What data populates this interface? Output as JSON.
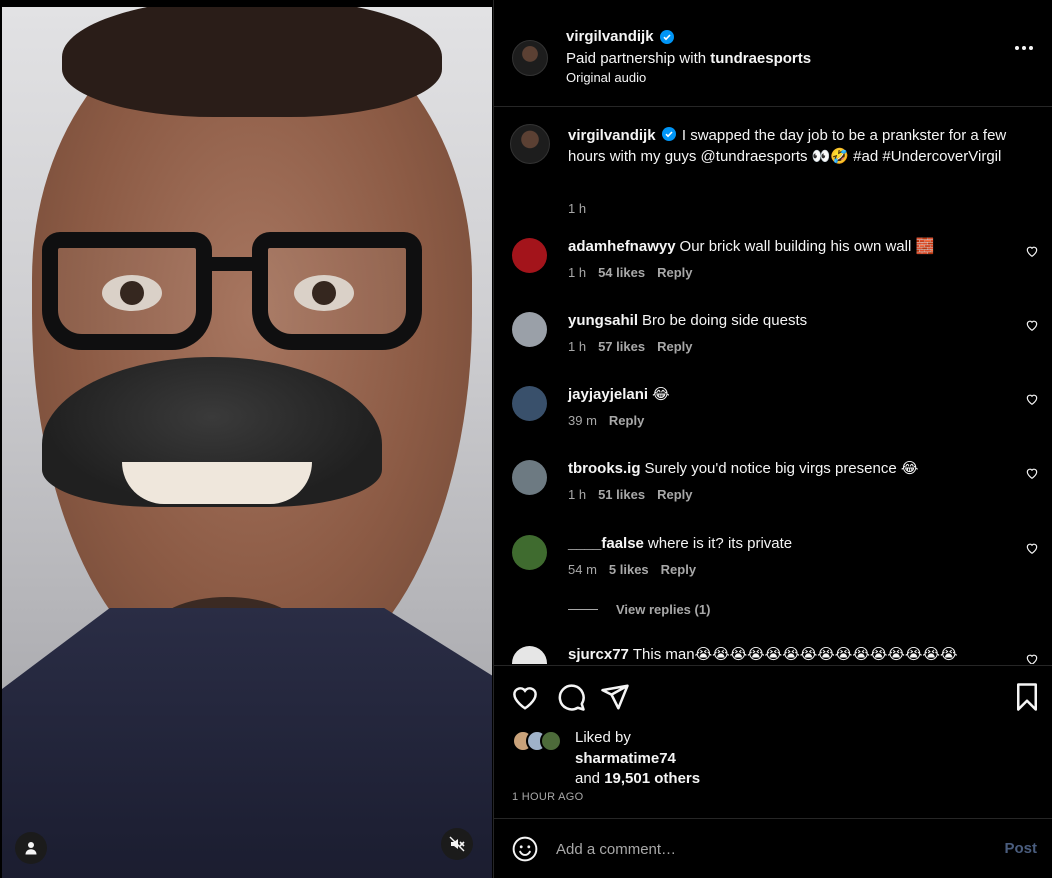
{
  "media": {
    "tag_icon": "person-icon",
    "mute_icon": "speaker-muted-icon"
  },
  "header": {
    "username": "virgilvandijk",
    "partnership_prefix": "Paid partnership with",
    "partner": "tundraesports",
    "audio": "Original audio",
    "more_icon": "more-horizontal-icon"
  },
  "caption": {
    "username": "virgilvandijk",
    "text": "I swapped the day job to be a prankster for a few hours with my guys @tundraesports 👀🤣 #ad #UndercoverVirgil",
    "time": "1 h"
  },
  "comments": [
    {
      "username": "adamhefnawyy",
      "text": "Our brick wall building his own wall 🧱",
      "time": "1 h",
      "likes": "54 likes",
      "reply": "Reply",
      "avatar_color": "#a3141b"
    },
    {
      "username": "yungsahil",
      "text": "Bro be doing side quests",
      "time": "1 h",
      "likes": "57 likes",
      "reply": "Reply",
      "avatar_color": "#9aa0a8"
    },
    {
      "username": "jayjayjelani",
      "text": "😂",
      "time": "39 m",
      "likes": "",
      "reply": "Reply",
      "avatar_color": "#39506b"
    },
    {
      "username": "tbrooks.ig",
      "text": "Surely you'd notice big virgs presence 😂",
      "time": "1 h",
      "likes": "51 likes",
      "reply": "Reply",
      "avatar_color": "#6d7a82"
    },
    {
      "username": "____faalse",
      "text": "where is it? its private",
      "time": "54 m",
      "likes": "5 likes",
      "reply": "Reply",
      "avatar_color": "#3f6b2f"
    },
    {
      "username": "sjurcx77",
      "text": "This man😭😭😭😭😭😭😭😭😭😭😭😭😭😭😭",
      "time": "",
      "likes": "",
      "reply": "",
      "avatar_color": "#e6e6e6"
    }
  ],
  "view_replies": "View replies (1)",
  "actions": {
    "like_icon": "heart-icon",
    "comment_icon": "comment-bubble-icon",
    "share_icon": "send-icon",
    "save_icon": "bookmark-icon"
  },
  "likes": {
    "liked_by": "Liked by",
    "user": "sharmatime74",
    "and": "and",
    "count": "19,501 others"
  },
  "posted_ago": "1 HOUR AGO",
  "composer": {
    "placeholder": "Add a comment…",
    "post": "Post",
    "emoji_icon": "smiley-face-icon"
  },
  "colors": {
    "background": "#000000",
    "text": "#f5f5f5",
    "secondary_text": "#a8a8a8",
    "verified": "#0095f6",
    "post_button_disabled": "#4a5d7e"
  }
}
